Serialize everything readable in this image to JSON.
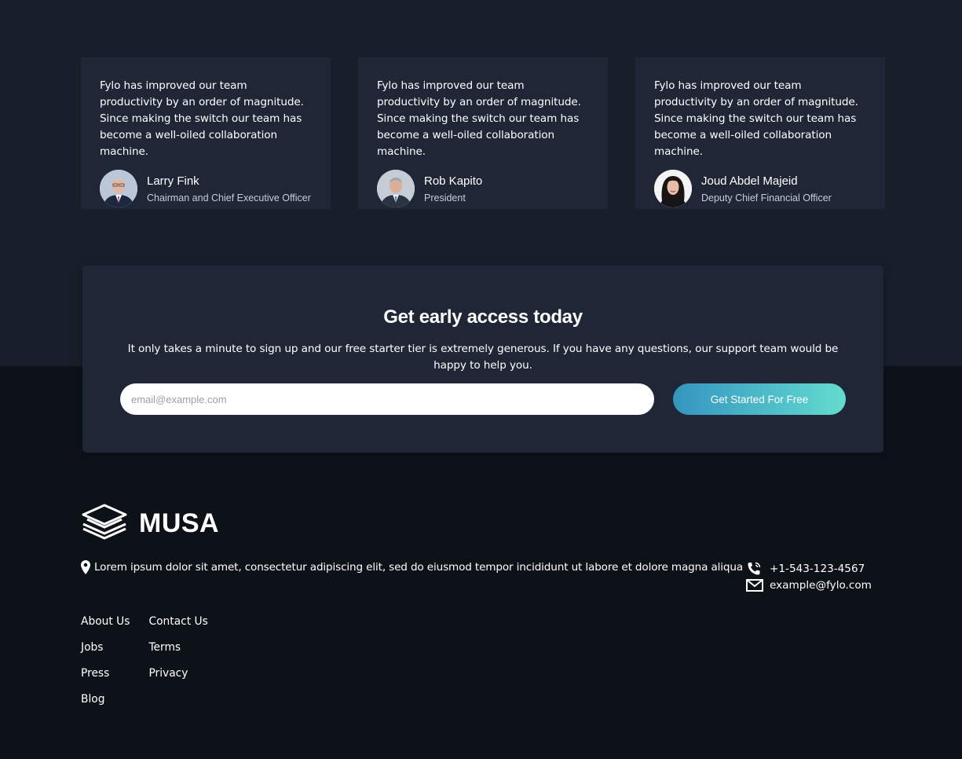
{
  "testimonials": [
    {
      "quote": "Fylo has improved our team productivity by an order of magnitude. Since making the switch our team has become a well-oiled collaboration machine.",
      "name": "Larry Fink",
      "role": "Chairman and Chief Executive Officer",
      "avatar": "man-glasses-portrait"
    },
    {
      "quote": "Fylo has improved our team productivity by an order of magnitude. Since making the switch our team has become a well-oiled collaboration machine.",
      "name": "Rob Kapito",
      "role": "President",
      "avatar": "man-grey-hair-portrait"
    },
    {
      "quote": "Fylo has improved our team productivity by an order of magnitude. Since making the switch our team has become a well-oiled collaboration machine.",
      "name": "Joud Abdel Majeid",
      "role": "Deputy Chief Financial Officer",
      "avatar": "woman-dark-hair-portrait"
    }
  ],
  "cta": {
    "title": "Get early access today",
    "text": "It only takes a minute to sign up and our free starter tier is extremely generous. If you have any questions, our support team would be happy to help you.",
    "email_placeholder": "email@example.com",
    "button_label": "Get Started For Free"
  },
  "footer": {
    "logo_text": "MUSA",
    "logo_icon": "stacked-layers-icon",
    "address": "Lorem ipsum dolor sit amet, consectetur adipiscing elit, sed do eiusmod tempor incididunt ut labore et dolore magna aliqua",
    "phone": "+1-543-123-4567",
    "email": "example@fylo.com",
    "links_col1": [
      "About Us",
      "Jobs",
      "Press",
      "Blog"
    ],
    "links_col2": [
      "Contact Us",
      "Terms",
      "Privacy"
    ]
  },
  "colors": {
    "page_bg": "#0d1219",
    "top_band_bg": "#181f2a",
    "card_bg": "#1f2737",
    "button_gradient_start": "#3495c0",
    "button_gradient_end": "#63dccf"
  }
}
